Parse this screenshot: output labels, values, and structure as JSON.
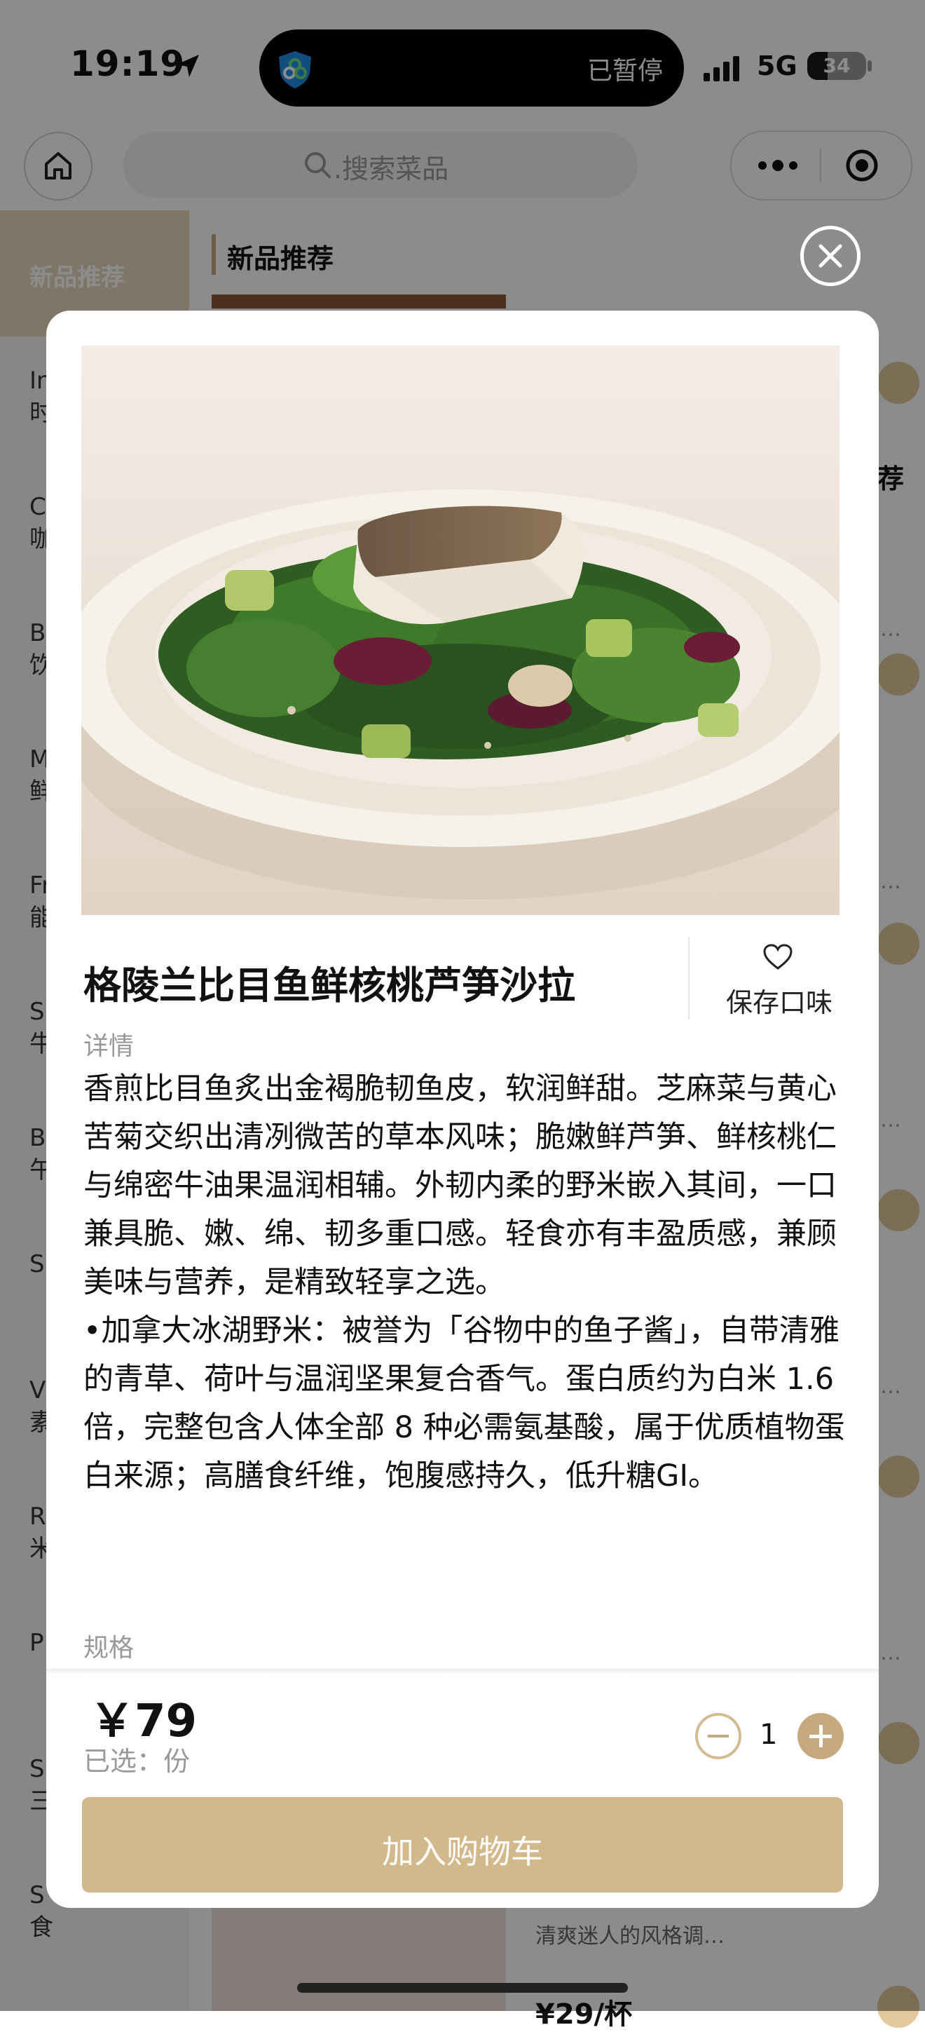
{
  "status_bar": {
    "time": "19:19",
    "island_text": "已暂停",
    "network": "5G",
    "battery": "34",
    "battery_level": 0.34
  },
  "header": {
    "search_placeholder": ".搜索菜品"
  },
  "sidebar": {
    "active_label": "新品推荐",
    "items": [
      {
        "line1": "In",
        "line2": "时"
      },
      {
        "line1": "C",
        "line2": "咖"
      },
      {
        "line1": "B",
        "line2": "饮"
      },
      {
        "line1": "M",
        "line2": "鲜"
      },
      {
        "line1": "Fr",
        "line2": "能"
      },
      {
        "line1": "S",
        "line2": "牛"
      },
      {
        "line1": "B",
        "line2": "午"
      },
      {
        "line1": "S",
        "line2": ""
      },
      {
        "line1": "V",
        "line2": "素"
      },
      {
        "line1": "R",
        "line2": "米"
      },
      {
        "line1": "P",
        "line2": ""
      },
      {
        "line1": "S",
        "line2": "三"
      },
      {
        "line1": "S",
        "line2": "食"
      }
    ]
  },
  "main": {
    "section_title": "新品推荐",
    "partial_word": "荐",
    "bottom_price": "¥29/杯",
    "bottom_text": "清爽迷人的风格调…"
  },
  "modal": {
    "title": "格陵兰比目鱼鲜核桃芦笋沙拉",
    "favorite_label": "保存口味",
    "detail_label": "详情",
    "description": [
      "香煎比目鱼炙出金褐脆韧鱼皮，软润鲜甜。芝麻菜与黄心苦菊交织出清冽微苦的草本风味；脆嫩鲜芦笋、鲜核桃仁与绵密牛油果温润相辅。外韧内柔的野米嵌入其间，一口兼具脆、嫩、绵、韧多重口感。轻食亦有丰盈质感，兼顾美味与营养，是精致轻享之选。",
      "•加拿大冰湖野米：被誉为「谷物中的鱼子酱」，自带清雅的青草、荷叶与温润坚果复合香气。蛋白质约为白米 1.6 倍，完整包含人体全部 8 种必需氨基酸，属于优质植物蛋白来源；高膳食纤维，饱腹感持久，低升糖GI。"
    ],
    "spec_label": "规格",
    "price": "￥79",
    "selected": "已选：份",
    "quantity": "1",
    "cart_button": "加入购物车"
  },
  "colors": {
    "accent": "#c6a97e",
    "cart_button": "#d2b98c",
    "sidebar_active": "#e9d8bd"
  },
  "icons": [
    "location-arrow-icon",
    "shield-icon",
    "signal-icon",
    "battery-icon",
    "home-icon",
    "search-icon",
    "more-dots-icon",
    "target-icon",
    "close-icon",
    "heart-icon",
    "minus-icon",
    "plus-icon"
  ]
}
